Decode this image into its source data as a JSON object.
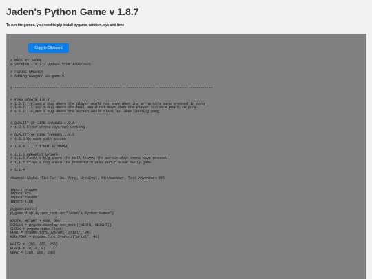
{
  "page": {
    "title": "Jaden's Python Game v 1.8.7",
    "instructions": "To run the games, you need to pip install pygame, random, sys and time"
  },
  "toolbar": {
    "copy_label": "Copy to Clipboard"
  },
  "code": {
    "lines": [
      "# MADE BY JADEN",
      "# Version 1.8.7 - Update from 4/06/2025",
      "",
      "# FUTURE UPDATES",
      "# Adding Hangman as game 6",
      "",
      "",
      "#-------------------------------------------------------------------------------------------------",
      "",
      "",
      "# PONG UPDATE 1.8.7",
      "# 1.8.7 - Fixed a bug where the player would not move when the arrow keys were pressed in pong",
      "# 1.8.7 - Fixed a bug where the ball would not move when the player scored a point in pong",
      "# 1.8.7 - Fixed a bug where the screen would blank out when loading pong",
      "",
      "",
      "# QUALITY OF LIFE CHANGES 1.8.6",
      "# 1.8.6 Fixed arrow keys not working",
      "",
      "# QUALITY OF LIFE CHANGES 1.8.5",
      "# 1.8.5 Re-made main screen",
      "",
      "# 1.8.4 - 1.2.1 NOT RECORDED",
      "",
      "# 1.1.5 BREAKOUT UPDATE",
      "# 1.1.5 Fixed a bug where the ball leaves the screen when arrow keys pressed",
      "# 1.1.5 Fixed a bug where the breakout blocks don't break early game",
      "",
      "# 1.1.4",
      "",
      "#Games: Snake, Tic Tac Toe, Pong, Breakout, Minesweeper, Text Adventure RPG",
      "",
      "",
      "import pygame",
      "import sys",
      "import random",
      "import time",
      "",
      "pygame.init()",
      "pygame.display.set_caption(\"Jaden's Python Games\")",
      "",
      "WIDTH, HEIGHT = 800, 600",
      "SCREEN = pygame.display.set_mode((WIDTH, HEIGHT))",
      "CLOCK = pygame.time.Clock()",
      "FONT = pygame.font.SysFont(\"arial\", 24)",
      "BIG_FONT = pygame.font.SysFont(\"arial\", 48)",
      "",
      "WHITE = (255, 255, 255)",
      "BLACK = (0, 0, 0)",
      "GRAY = (200, 200, 200)"
    ]
  },
  "colors": {
    "panel_background": "#808080",
    "button_background": "#0b7de6",
    "page_background": "#f2f2f2"
  }
}
